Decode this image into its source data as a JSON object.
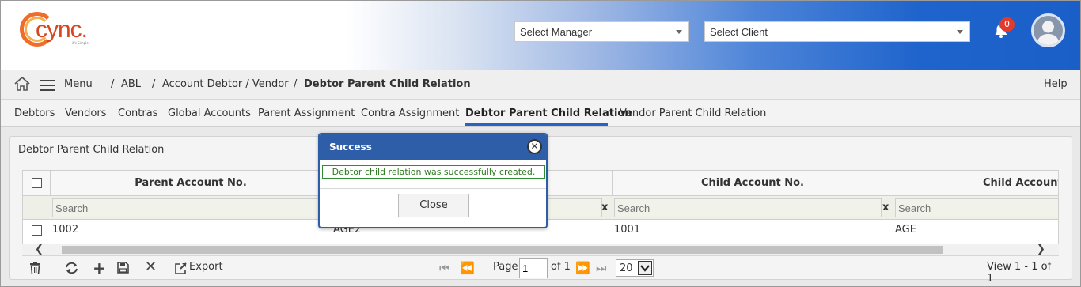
{
  "header": {
    "logo_text": "cync.",
    "logo_tagline": "it's Simple",
    "manager_select": "Select Manager",
    "client_select": "Select Client",
    "notification_count": "0"
  },
  "breadcrumb": {
    "menu_label": "Menu",
    "items": [
      "ABL",
      "Account Debtor / Vendor",
      "Debtor Parent Child Relation"
    ],
    "separator": "/",
    "help": "Help"
  },
  "tabs": [
    {
      "label": "Debtors"
    },
    {
      "label": "Vendors"
    },
    {
      "label": "Contras"
    },
    {
      "label": "Global Accounts"
    },
    {
      "label": "Parent Assignment"
    },
    {
      "label": "Contra Assignment"
    },
    {
      "label": "Debtor Parent Child Relation",
      "active": true
    },
    {
      "label": "Vendor Parent Child Relation"
    }
  ],
  "panel": {
    "title": "Debtor Parent Child Relation",
    "columns": [
      "Parent Account No.",
      "Child Account No.",
      "Child Account N"
    ],
    "search_placeholder": "Search",
    "clear_label": "x",
    "rows": [
      {
        "parent_no": "1002",
        "parent_name": "AGE2",
        "child_no": "1001",
        "child_name": "AGE"
      }
    ]
  },
  "pager": {
    "export": "Export",
    "page_label": "Page",
    "page_value": "1",
    "of_label": "of 1",
    "page_size": "20",
    "view_text": "View 1 - 1 of 1"
  },
  "modal": {
    "title": "Success",
    "message": "Debtor child relation was successfully created.",
    "close_button": "Close"
  },
  "colors": {
    "primary": "#2f5ea8",
    "active_tab": "#2863c4",
    "success_text": "#2d7a20",
    "badge": "#e23b2e"
  }
}
